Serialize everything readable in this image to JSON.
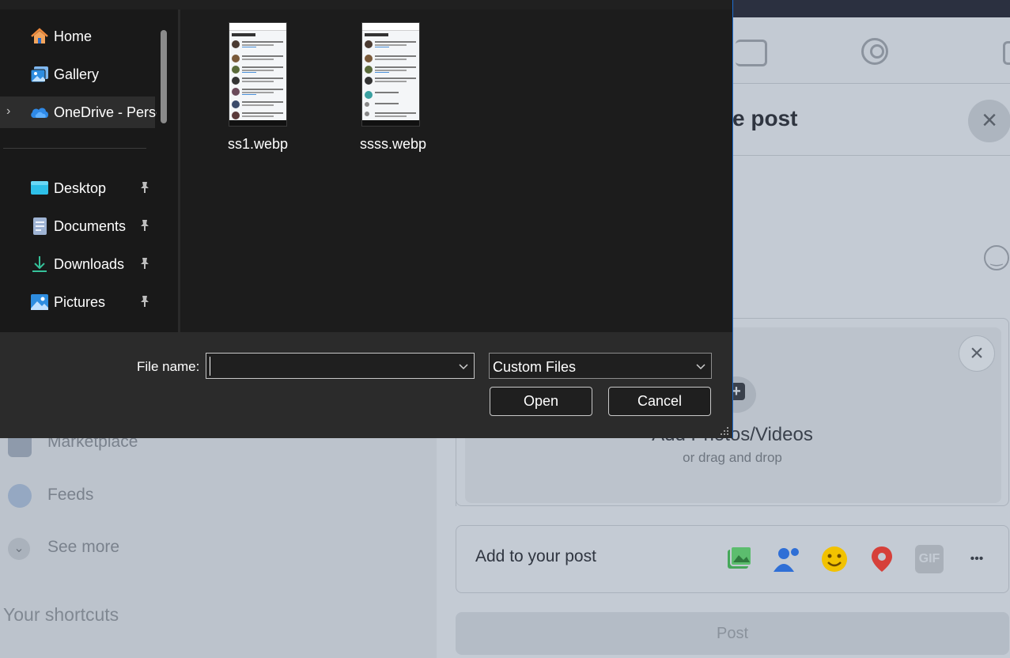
{
  "dialog": {
    "nav": {
      "quick": [
        {
          "label": "Home",
          "icon": "home-icon"
        },
        {
          "label": "Gallery",
          "icon": "gallery-icon"
        },
        {
          "label": "OneDrive - Personal",
          "icon": "onedrive-cloud-icon"
        }
      ],
      "pinned": [
        {
          "label": "Desktop",
          "icon": "desktop-folder-icon"
        },
        {
          "label": "Documents",
          "icon": "documents-folder-icon"
        },
        {
          "label": "Downloads",
          "icon": "downloads-folder-icon"
        },
        {
          "label": "Pictures",
          "icon": "pictures-folder-icon"
        }
      ]
    },
    "files": [
      {
        "name": "ss1.webp"
      },
      {
        "name": "ssss.webp"
      }
    ],
    "file_name_label": "File name:",
    "file_name_value": "",
    "file_type": "Custom Files",
    "open_label": "Open",
    "cancel_label": "Cancel"
  },
  "background": {
    "sidebar": {
      "marketplace": "Marketplace",
      "feeds": "Feeds",
      "see_more": "See more",
      "shortcuts_heading": "Your shortcuts"
    },
    "modal": {
      "title_fragment": "e post",
      "add_photos_title": "Add Photos/Videos",
      "add_photos_sub": "or drag and drop",
      "add_to_post": "Add to your post",
      "gif_label": "GIF",
      "more_label": "•••",
      "post_button": "Post"
    }
  },
  "colors": {
    "dialog_accent": "#1f6fd1",
    "dialog_bg": "#1c1c1c",
    "bottom_bar_bg": "#2b2b2b"
  }
}
